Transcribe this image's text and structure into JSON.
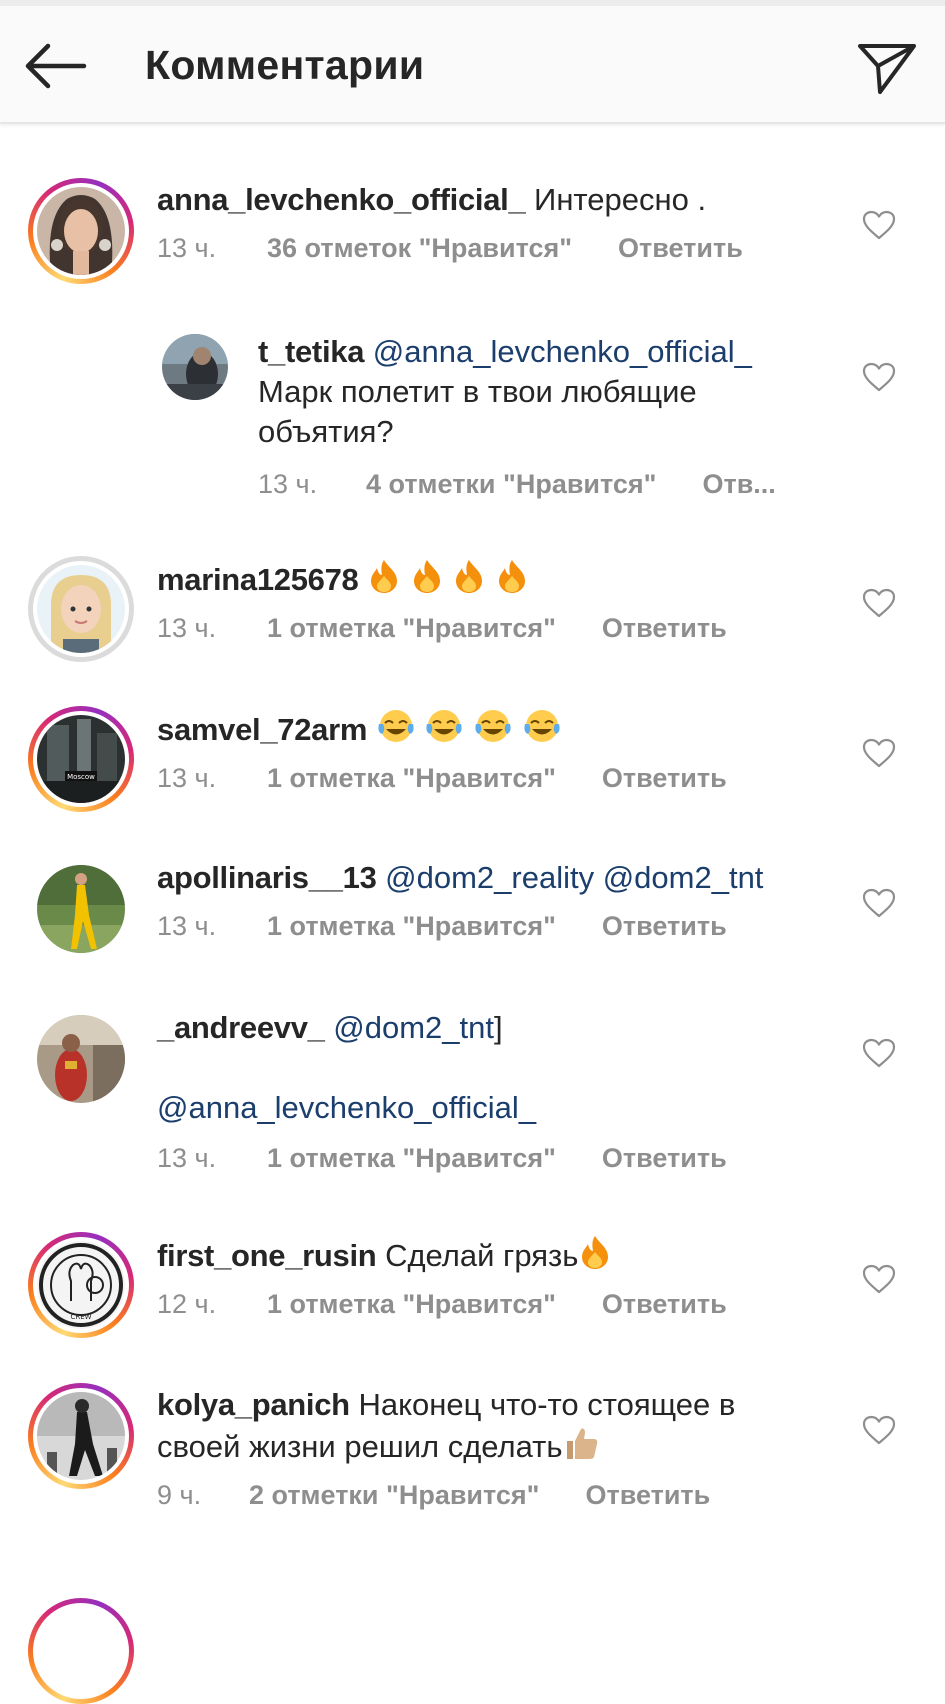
{
  "header": {
    "title": "Комментарии",
    "back_icon": "arrow-left-icon",
    "share_icon": "paper-plane-icon"
  },
  "colors": {
    "text": "#262626",
    "muted": "#8e8e8e",
    "mention": "#1b3e6d",
    "header_bg": "#fafafa"
  },
  "comments": [
    {
      "username": "anna_levchenko_official_",
      "text": "Интересно .",
      "time": "13 ч.",
      "likes": "36 отметок \"Нравится\"",
      "reply": "Ответить",
      "story_ring": true
    },
    {
      "username": "t_tetika",
      "mention": "@anna_levchenko_official_",
      "text_line2": "Марк полетит в твои любящие",
      "text_line3": "объятия?",
      "time": "13 ч.",
      "likes": "4 отметки \"Нравится\"",
      "reply": "Отв...",
      "is_reply": true
    },
    {
      "username": "marina125678",
      "emoji": "fire-emoji x4",
      "time": "13 ч.",
      "likes": "1 отметка \"Нравится\"",
      "reply": "Ответить",
      "story_ring": false
    },
    {
      "username": "samvel_72arm",
      "emoji": "tears-of-joy-emoji x4",
      "time": "13 ч.",
      "likes": "1 отметка \"Нравится\"",
      "reply": "Ответить",
      "story_ring": true,
      "avatar_caption": "Moscow"
    },
    {
      "username": "apollinaris__13",
      "mentions": "@dom2_reality @dom2_tnt",
      "time": "13 ч.",
      "likes": "1 отметка \"Нравится\"",
      "reply": "Ответить",
      "story_ring": false
    },
    {
      "username": "_andreevv_",
      "mention": "@dom2_tnt",
      "trailing": "]",
      "mention2": "@anna_levchenko_official_",
      "time": "13 ч.",
      "likes": "1 отметка \"Нравится\"",
      "reply": "Ответить",
      "story_ring": false
    },
    {
      "username": "first_one_rusin",
      "text": "Сделай грязь",
      "emoji": "fire-emoji",
      "time": "12 ч.",
      "likes": "1 отметка \"Нравится\"",
      "reply": "Ответить",
      "story_ring": true,
      "avatar_caption": "CREW"
    },
    {
      "username": "kolya_panich",
      "text": "Наконец что-то стоящее в",
      "text_line2": "своей жизни решил сделать",
      "emoji": "thumbs-up-emoji",
      "time": "9 ч.",
      "likes": "2 отметки \"Нравится\"",
      "reply": "Ответить",
      "story_ring": true
    }
  ]
}
